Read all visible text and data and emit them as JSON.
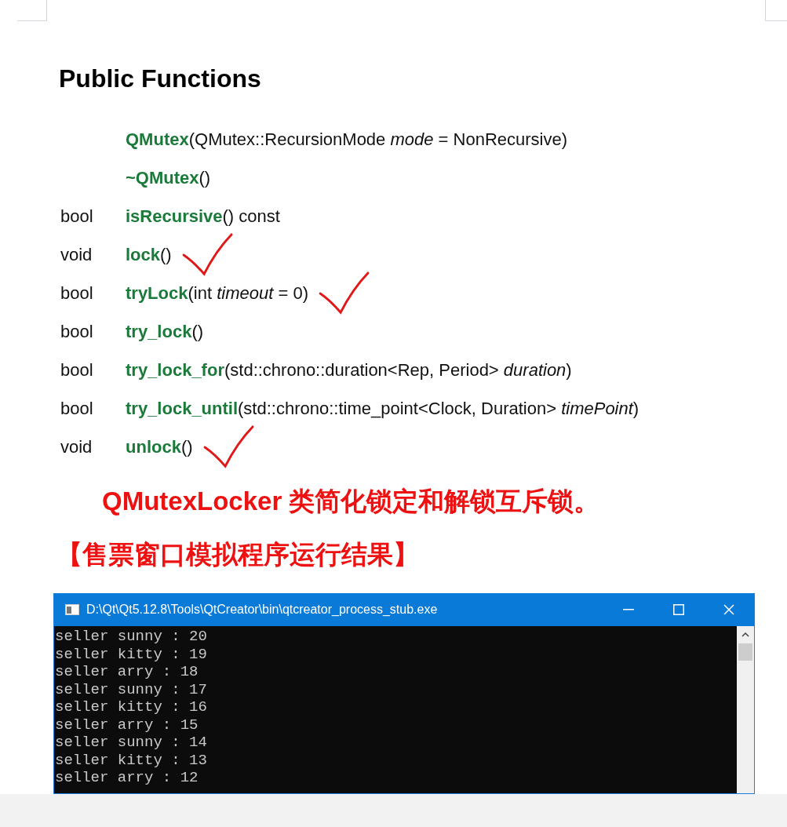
{
  "heading": "Public Functions",
  "functions": [
    {
      "name": "QMutex",
      "rest": "(QMutex::RecursionMode *mode* = NonRecursive)",
      "marked": false
    },
    {
      "name": "~QMutex",
      "rest": "()",
      "marked": false
    },
    {
      "type": "bool",
      "name": "isRecursive",
      "rest": "() const",
      "marked": false
    },
    {
      "type": "void",
      "name": "lock",
      "rest": "()",
      "marked": true
    },
    {
      "type": "bool",
      "name": "tryLock",
      "rest": "(int *timeout* = 0)",
      "marked": true
    },
    {
      "type": "bool",
      "name": "try_lock",
      "rest": "()",
      "marked": false
    },
    {
      "type": "bool",
      "name": "try_lock_for",
      "rest": "(std::chrono::duration<Rep, Period> *duration*)",
      "marked": false
    },
    {
      "type": "bool",
      "name": "try_lock_until",
      "rest": "(std::chrono::time_point<Clock, Duration> *timePoint*)",
      "marked": false
    },
    {
      "type": "void",
      "name": "unlock",
      "rest": "()",
      "marked": true
    }
  ],
  "note": "QMutexLocker 类简化锁定和解锁互斥锁。",
  "section_title": "【售票窗口模拟程序运行结果】",
  "console": {
    "title": "D:\\Qt\\Qt5.12.8\\Tools\\QtCreator\\bin\\qtcreator_process_stub.exe",
    "lines": [
      "seller sunny : 20",
      "seller kitty : 19",
      "seller arry : 18",
      "seller sunny : 17",
      "seller kitty : 16",
      "seller arry : 15",
      "seller sunny : 14",
      "seller kitty : 13",
      "seller arry : 12"
    ]
  }
}
